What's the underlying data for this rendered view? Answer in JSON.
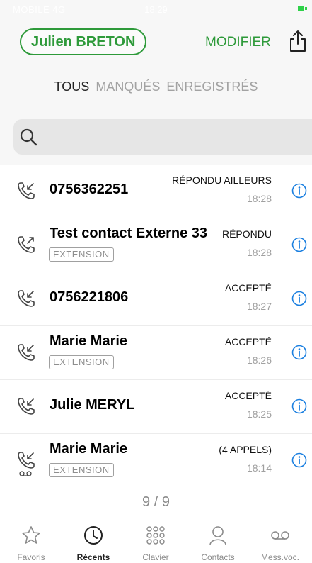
{
  "status_bar": {
    "carrier": "MOBILE 4G",
    "time": "18:29"
  },
  "header": {
    "user_name": "Julien BRETON",
    "modify_label": "MODIFIER"
  },
  "filters": {
    "all": "TOUS",
    "missed": "MANQUÉS",
    "recorded": "ENREGISTRÉS"
  },
  "search": {
    "placeholder": ""
  },
  "calls": [
    {
      "name": "0756362251",
      "tag": "",
      "status": "RÉPONDU AILLEURS",
      "time": "18:28",
      "direction": "incoming"
    },
    {
      "name": "Test contact  Externe 33",
      "tag": "EXTENSION",
      "status": "RÉPONDU",
      "time": "18:28",
      "direction": "outgoing"
    },
    {
      "name": "0756221806",
      "tag": "",
      "status": "ACCEPTÉ",
      "time": "18:27",
      "direction": "incoming"
    },
    {
      "name": "Marie Marie",
      "tag": "EXTENSION",
      "status": "ACCEPTÉ",
      "time": "18:26",
      "direction": "incoming"
    },
    {
      "name": "Julie MERYL",
      "tag": "",
      "status": "ACCEPTÉ",
      "time": "18:25",
      "direction": "incoming"
    },
    {
      "name": "Marie Marie",
      "tag": "EXTENSION",
      "status": "(4 APPELS)",
      "time": "18:14",
      "direction": "incoming-voicemail"
    }
  ],
  "counter": "9 / 9",
  "tabs": [
    {
      "label": "Favoris",
      "icon": "star-icon"
    },
    {
      "label": "Récents",
      "icon": "clock-icon",
      "active": true
    },
    {
      "label": "Clavier",
      "icon": "keypad-icon"
    },
    {
      "label": "Contacts",
      "icon": "person-icon"
    },
    {
      "label": "Mess.voc.",
      "icon": "voicemail-icon"
    }
  ],
  "colors": {
    "brand_green": "#2e9a3a",
    "info_blue": "#1a7fe0",
    "muted_gray": "#a2a2a2"
  }
}
